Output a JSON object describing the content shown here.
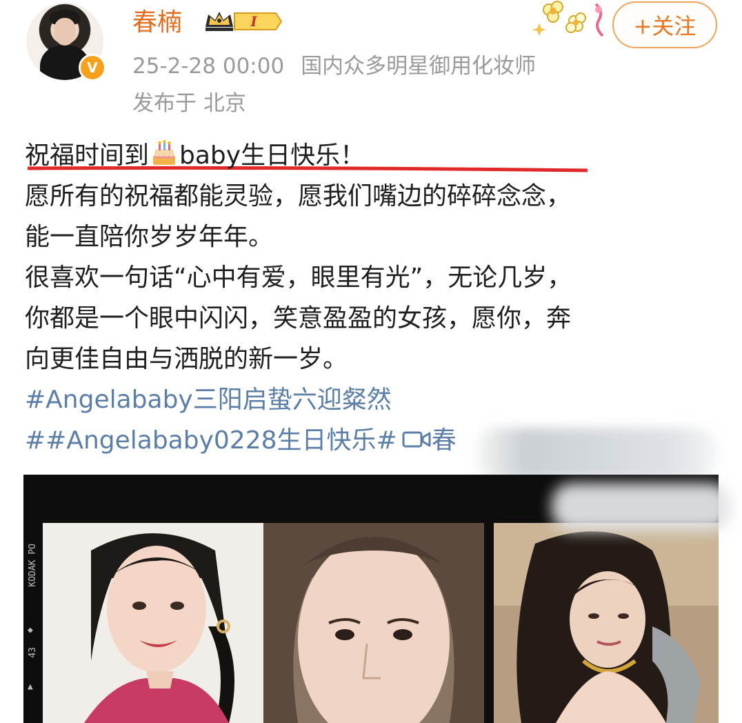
{
  "user": {
    "name": "春楠",
    "level": "I",
    "timestamp": "25-2-28 00:00",
    "description": "国内众多明星御用化妆师",
    "location": "发布于 北京",
    "verified": "V",
    "follow_label": "+关注"
  },
  "post": {
    "line1_a": "祝福时间到",
    "line1_b": "baby生日快乐！",
    "line2": "愿所有的祝福都能灵验，愿我们嘴边的碎碎念念，",
    "line3": "能一直陪你岁岁年年。",
    "line4": "很喜欢一句话“心中有爱，眼里有光”，无论几岁，",
    "line5": "你都是一个眼中闪闪，笑意盈盈的女孩，愿你，奔",
    "line6": "向更佳自由与洒脱的新一岁。",
    "hashtag1": "#Angelababy三阳启蛰六迎粲然",
    "hashtag2": "##Angelababy0228生日快乐#",
    "video_link_partial": "春"
  },
  "image": {
    "film_text": "KODAK PO",
    "film_numbers": [
      "43"
    ]
  },
  "colors": {
    "username": "#e66c1e",
    "meta": "#9a9a9a",
    "hashtag": "#5b7ea8",
    "follow_border": "#f0a35a",
    "underline": "#e02828"
  }
}
